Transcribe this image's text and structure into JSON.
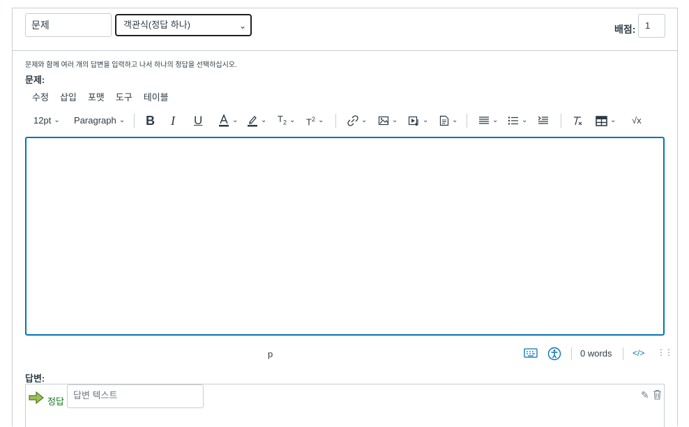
{
  "question": {
    "name_value": "문제",
    "type_selected": "객관식(정답 하나)",
    "points_label": "배점:",
    "points_value": "1",
    "instructions": "문제와 함께 여러 개의 답변을 입력하고 나서 하나의 정답을 선택하십시오.",
    "label": "문제:"
  },
  "editor": {
    "menus": [
      "수정",
      "삽입",
      "포맷",
      "도구",
      "테이블"
    ],
    "font_size": "12pt",
    "block_format": "Paragraph",
    "status_path": "p",
    "word_count": "0 words",
    "html_toggle": "</>"
  },
  "answers": {
    "label": "답변:",
    "items": [
      {
        "correct_label": "정답",
        "placeholder": "답변 텍스트"
      }
    ]
  },
  "colors": {
    "accent": "#0374b5",
    "correct": "#127a1b",
    "border": "#c7cdd1"
  }
}
